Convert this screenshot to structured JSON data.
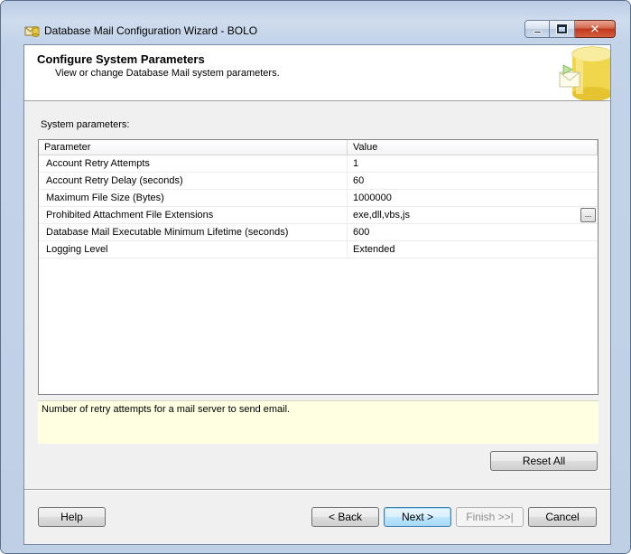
{
  "window": {
    "title": "Database Mail Configuration Wizard - BOLO",
    "icon": "database-mail-icon"
  },
  "header": {
    "title": "Configure System Parameters",
    "subtitle": "View or change Database Mail system parameters."
  },
  "section_label": "System parameters:",
  "grid": {
    "columns": [
      "Parameter",
      "Value"
    ],
    "rows": [
      {
        "parameter": "Account Retry Attempts",
        "value": "1"
      },
      {
        "parameter": "Account Retry Delay (seconds)",
        "value": "60"
      },
      {
        "parameter": "Maximum File Size (Bytes)",
        "value": "1000000"
      },
      {
        "parameter": "Prohibited Attachment File Extensions",
        "value": "exe,dll,vbs,js",
        "ellipsis": "..."
      },
      {
        "parameter": "Database Mail Executable Minimum Lifetime (seconds)",
        "value": "600"
      },
      {
        "parameter": "Logging Level",
        "value": "Extended"
      }
    ]
  },
  "description": "Number of retry attempts for a mail server to send email.",
  "buttons": {
    "reset_all": "Reset All",
    "help": "Help",
    "back": "< Back",
    "next": "Next >",
    "finish": "Finish >>|",
    "cancel": "Cancel"
  },
  "colors": {
    "description_bg": "#ffffe1",
    "focus_blue": "#3c7fb1"
  }
}
